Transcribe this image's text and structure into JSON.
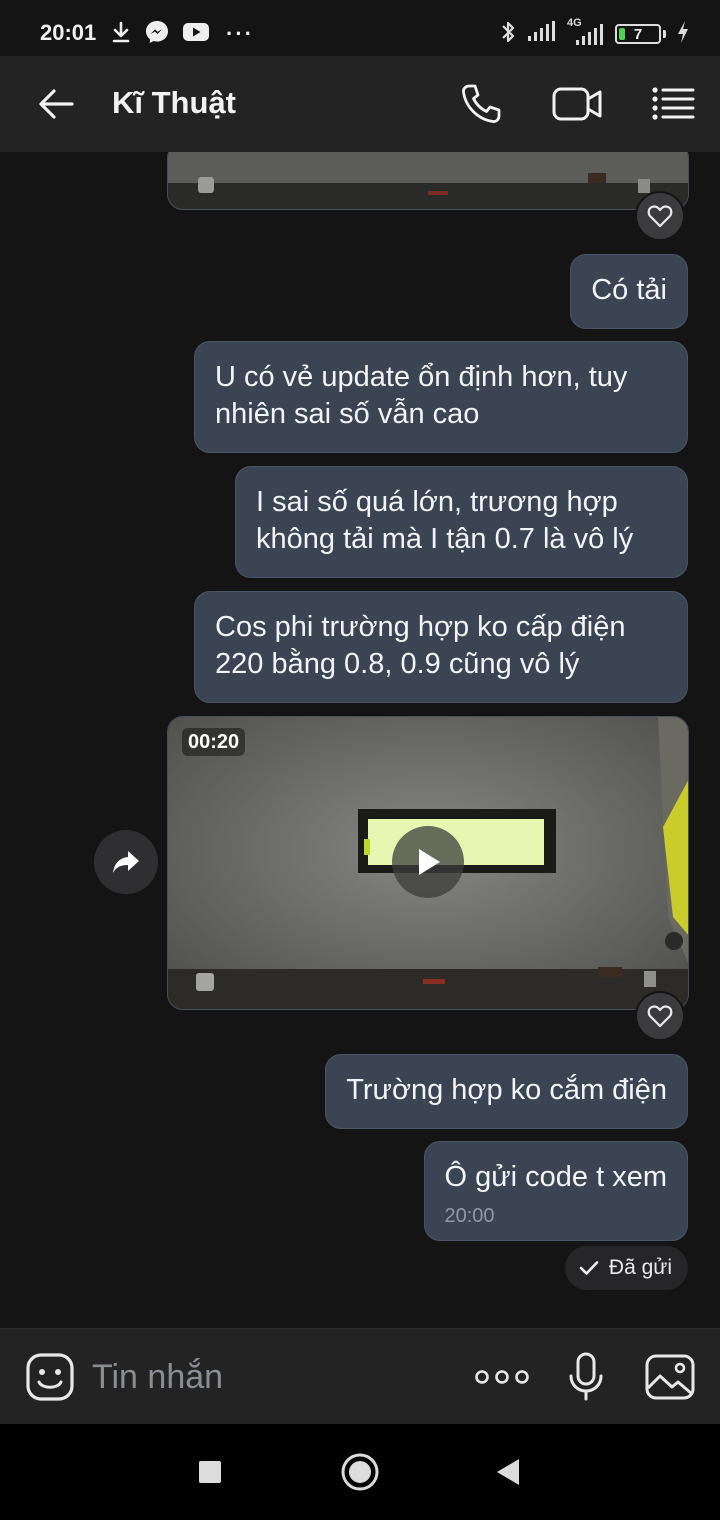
{
  "status_bar": {
    "time": "20:01",
    "battery": "7",
    "left_icons": [
      "download-icon",
      "messenger-icon",
      "youtube-icon",
      "more-dots"
    ],
    "right_icons": [
      "bluetooth-icon",
      "signal-icon",
      "4g-signal-icon",
      "battery-icon",
      "charging-icon"
    ],
    "network_label": "4G"
  },
  "header": {
    "title": "Kĩ Thuật",
    "icons": [
      "back-arrow-icon",
      "phone-icon",
      "video-camera-icon",
      "menu-list-icon"
    ]
  },
  "messages": [
    {
      "text": "Có tải"
    },
    {
      "text": "U có vẻ update ổn định hơn, tuy nhiên sai số vẫn cao"
    },
    {
      "text": "I sai số quá lớn, trương hợp không tải mà I tận 0.7 là vô lý"
    },
    {
      "text": "Cos phi trường hợp ko cấp điện 220 bằng 0.8, 0.9 cũng vô lý"
    },
    {
      "text": "Trường hợp ko cắm điện"
    },
    {
      "text": "Ô gửi code t xem",
      "time": "20:00"
    }
  ],
  "video": {
    "duration": "00:20"
  },
  "delivery_status": "Đã gửi",
  "composer": {
    "placeholder": "Tin nhắn",
    "icons": [
      "emoji-icon",
      "more-options-icon",
      "microphone-icon",
      "image-icon"
    ]
  },
  "colors": {
    "background": "#141414",
    "bubble": "#3a4452",
    "header": "#232323",
    "text": "#f1f4f8"
  }
}
